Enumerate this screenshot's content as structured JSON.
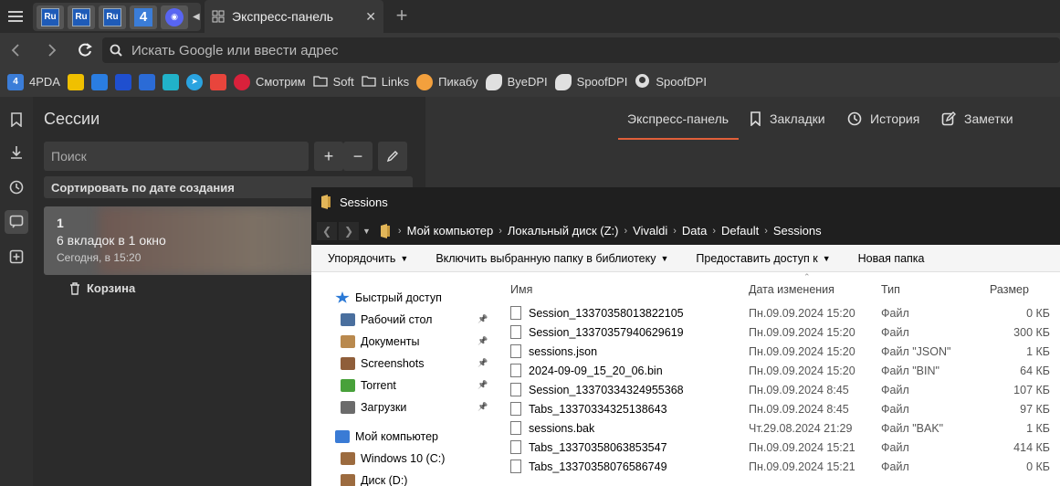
{
  "tabbar": {
    "stacked_tabs": [
      {
        "icon": "ru-icon",
        "label": "Ru"
      },
      {
        "icon": "ru-icon",
        "label": "Ru"
      },
      {
        "icon": "ru-icon",
        "label": "Ru"
      },
      {
        "icon": "4pda-icon",
        "label": "4"
      },
      {
        "icon": "discord-icon",
        "label": ""
      }
    ],
    "active_tab": "Экспресс-панель"
  },
  "address": {
    "placeholder": "Искать Google или ввести адрес"
  },
  "bookmarks": [
    {
      "label": "4PDA",
      "icon": "4pda-icon",
      "color": "#3b7dd8"
    },
    {
      "label": "",
      "icon": "bookmark-icon-2",
      "color": "#f0c000"
    },
    {
      "label": "",
      "icon": "bookmark-icon-3",
      "color": "#2a7de1"
    },
    {
      "label": "",
      "icon": "bookmark-icon-4",
      "color": "#1f4fcf"
    },
    {
      "label": "",
      "icon": "bookmark-icon-5",
      "color": "#2b6bd6"
    },
    {
      "label": "",
      "icon": "bookmark-icon-6",
      "color": "#21b2c9"
    },
    {
      "label": "",
      "icon": "telegram-icon",
      "color": "#2aa3e0"
    },
    {
      "label": "",
      "icon": "bookmark-icon-8",
      "color": "#e8453c"
    },
    {
      "label": "Смотрим",
      "icon": "smotrim-icon",
      "color": "#d9213b"
    },
    {
      "label": "Soft",
      "icon": "folder-icon",
      "color": ""
    },
    {
      "label": "Links",
      "icon": "folder-icon",
      "color": ""
    },
    {
      "label": "Пикабу",
      "icon": "pikabu-icon",
      "color": "#f3a03d"
    },
    {
      "label": "ByeDPI",
      "icon": "byedpi-icon",
      "color": "#e0e0e0"
    },
    {
      "label": "SpoofDPI",
      "icon": "spoofdpi-icon",
      "color": "#e0e0e0"
    },
    {
      "label": "SpoofDPI",
      "icon": "github-icon",
      "color": "#dddddd"
    }
  ],
  "panel": {
    "title": "Сессии",
    "search_placeholder": "Поиск",
    "sort_label": "Сортировать по дате создания",
    "session": {
      "number": "1",
      "count": "6 вкладок в 1 окно",
      "date": "Сегодня, в 15:20"
    },
    "trash_label": "Корзина"
  },
  "main_tabs": [
    "Экспресс-панель",
    "Закладки",
    "История",
    "Заметки"
  ],
  "explorer": {
    "title": "Sessions",
    "breadcrumb": [
      "Мой компьютер",
      "Локальный диск (Z:)",
      "Vivaldi",
      "Data",
      "Default",
      "Sessions"
    ],
    "toolbar": [
      {
        "label": "Упорядочить",
        "dropdown": true
      },
      {
        "label": "Включить выбранную папку в библиотеку",
        "dropdown": true
      },
      {
        "label": "Предоставить доступ к",
        "dropdown": true
      },
      {
        "label": "Новая папка",
        "dropdown": false
      }
    ],
    "nav": {
      "quick_access": "Быстрый доступ",
      "pinned": [
        "Рабочий стол",
        "Документы",
        "Screenshots",
        "Torrent",
        "Загрузки"
      ],
      "computer": "Мой компьютер",
      "drives": [
        "Windows 10 (C:)",
        "Диск (D:)"
      ]
    },
    "columns": {
      "name": "Имя",
      "date": "Дата изменения",
      "type": "Тип",
      "size": "Размер"
    },
    "files": [
      {
        "name": "Session_13370358013822105",
        "date": "Пн.09.09.2024 15:20",
        "type": "Файл",
        "size": "0 КБ"
      },
      {
        "name": "Session_13370357940629619",
        "date": "Пн.09.09.2024 15:20",
        "type": "Файл",
        "size": "300 КБ"
      },
      {
        "name": "sessions.json",
        "date": "Пн.09.09.2024 15:20",
        "type": "Файл \"JSON\"",
        "size": "1 КБ"
      },
      {
        "name": "2024-09-09_15_20_06.bin",
        "date": "Пн.09.09.2024 15:20",
        "type": "Файл \"BIN\"",
        "size": "64 КБ"
      },
      {
        "name": "Session_13370334324955368",
        "date": "Пн.09.09.2024 8:45",
        "type": "Файл",
        "size": "107 КБ"
      },
      {
        "name": "Tabs_13370334325138643",
        "date": "Пн.09.09.2024 8:45",
        "type": "Файл",
        "size": "97 КБ"
      },
      {
        "name": "sessions.bak",
        "date": "Чт.29.08.2024 21:29",
        "type": "Файл \"BAK\"",
        "size": "1 КБ"
      },
      {
        "name": "Tabs_13370358063853547",
        "date": "Пн.09.09.2024 15:21",
        "type": "Файл",
        "size": "414 КБ"
      },
      {
        "name": "Tabs_13370358076586749",
        "date": "Пн.09.09.2024 15:21",
        "type": "Файл",
        "size": "0 КБ"
      }
    ]
  }
}
